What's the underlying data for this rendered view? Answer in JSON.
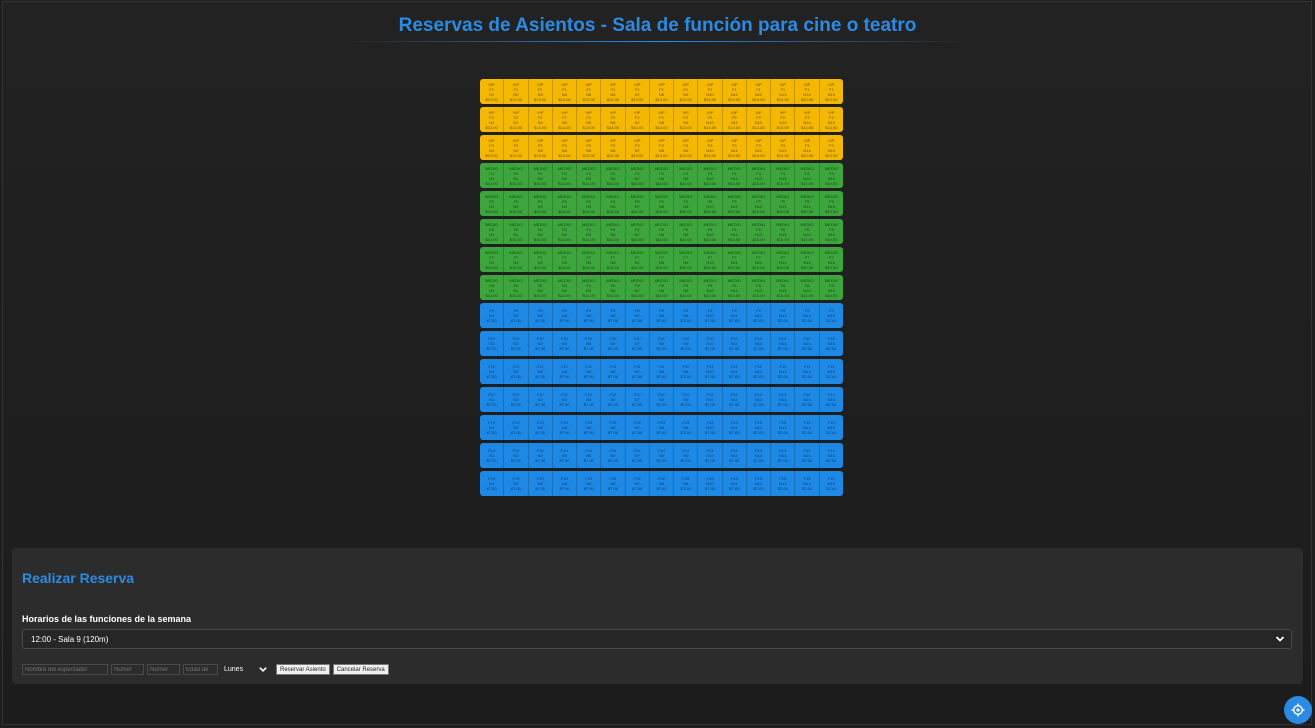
{
  "header": {
    "title": "Reservas de Asientos - Sala de función para cine o teatro"
  },
  "seating": {
    "rows": [
      {
        "type": "vip",
        "label": "VIP",
        "row": "F1",
        "price": "$13.00"
      },
      {
        "type": "vip",
        "label": "VIP",
        "row": "F2",
        "price": "$13.00"
      },
      {
        "type": "vip",
        "label": "VIP",
        "row": "F3",
        "price": "$13.00"
      },
      {
        "type": "medio",
        "label": "MEDIO",
        "row": "F4",
        "price": "$10.00"
      },
      {
        "type": "medio",
        "label": "MEDIO",
        "row": "F5",
        "price": "$10.00"
      },
      {
        "type": "medio",
        "label": "MEDIO",
        "row": "F6",
        "price": "$10.00"
      },
      {
        "type": "medio",
        "label": "MEDIO",
        "row": "F7",
        "price": "$10.00"
      },
      {
        "type": "medio",
        "label": "MEDIO",
        "row": "F8",
        "price": "$10.00"
      },
      {
        "type": "gen",
        "label": "",
        "row": "F9",
        "price": "$7.00"
      },
      {
        "type": "gen",
        "label": "",
        "row": "F10",
        "price": "$7.00"
      },
      {
        "type": "gen",
        "label": "",
        "row": "F11",
        "price": "$7.00"
      },
      {
        "type": "gen",
        "label": "",
        "row": "F12",
        "price": "$7.00"
      },
      {
        "type": "gen",
        "label": "",
        "row": "F13",
        "price": "$7.00"
      },
      {
        "type": "gen",
        "label": "",
        "row": "F14",
        "price": "$7.00"
      },
      {
        "type": "gen",
        "label": "",
        "row": "F15",
        "price": "$7.00"
      }
    ],
    "seat_numbers": [
      "N1",
      "N2",
      "N3",
      "N4",
      "N5",
      "N6",
      "N7",
      "N8",
      "N9",
      "N10",
      "N11",
      "N12",
      "N13",
      "N14",
      "N15"
    ]
  },
  "reservation": {
    "title": "Realizar Reserva",
    "schedule_label": "Horarios de las funciones de la semana",
    "schedule_selected": "12:00 - Sala 9 (120m)",
    "name_placeholder": "Nombre del espectador",
    "row_placeholder": "Númer",
    "seat_placeholder": "Númer",
    "age_placeholder": "Edad de",
    "day_selected": "Lunes",
    "reserve_label": "Reservar Asiento",
    "cancel_label": "Cancelar Reserva"
  },
  "colors": {
    "accent": "#2b8be4",
    "vip": "#f5b800",
    "medio": "#3ca63c",
    "general": "#1e88e5"
  },
  "icons": {
    "fab": "settings-icon",
    "dropdown": "chevron-down-icon"
  }
}
